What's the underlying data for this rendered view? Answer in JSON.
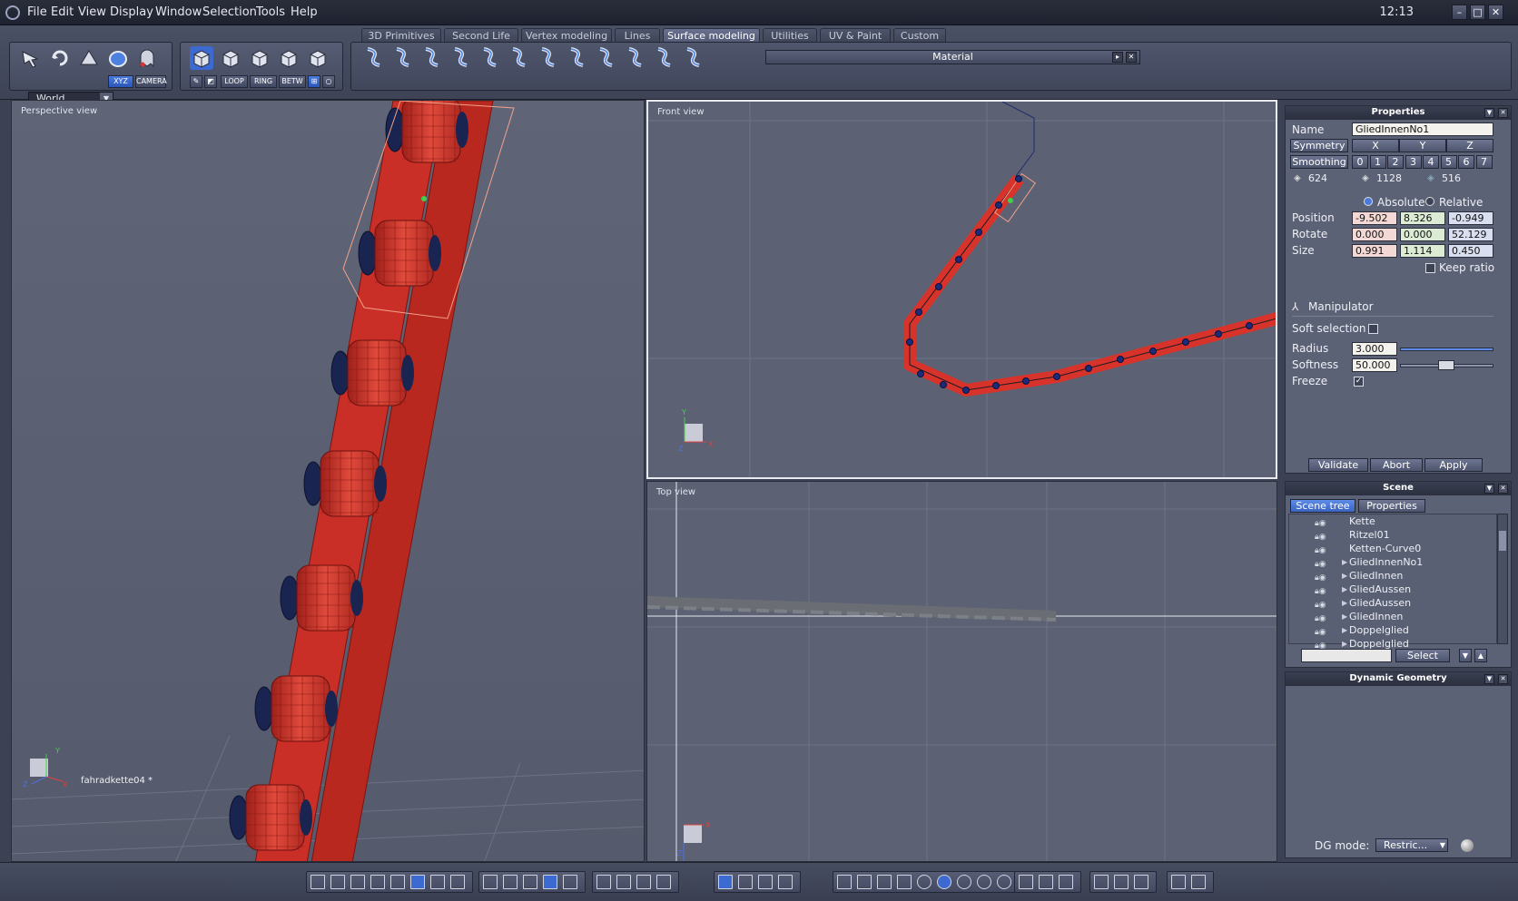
{
  "menubar": {
    "items": [
      "File",
      "Edit",
      "View",
      "Display",
      "Window",
      "Selection",
      "Tools",
      "Help"
    ],
    "clock": "12:13"
  },
  "toolbar": {
    "world_select": "World",
    "mode_buttons": [
      "XYZ",
      "CAMERA"
    ],
    "selection_buttons": [
      "LOOP",
      "RING",
      "BETW"
    ],
    "tabs": [
      "3D Primitives",
      "Second Life",
      "Vertex modeling",
      "Lines",
      "Surface modeling",
      "Utilities",
      "UV & Paint",
      "Custom"
    ],
    "active_tab": "Surface modeling",
    "material_label": "Material"
  },
  "viewports": {
    "perspective": {
      "title": "Perspective view",
      "object_label": "fahradkette04 *"
    },
    "front": {
      "title": "Front view"
    },
    "top": {
      "title": "Top view"
    }
  },
  "properties": {
    "title": "Properties",
    "name_label": "Name",
    "name_value": "GliedInnenNo1",
    "symmetry_label": "Symmetry",
    "symmetry_axes": [
      "X",
      "Y",
      "Z"
    ],
    "smoothing_label": "Smoothing",
    "smoothing_levels": [
      "0",
      "1",
      "2",
      "3",
      "4",
      "5",
      "6",
      "7"
    ],
    "counts": [
      "624",
      "1128",
      "516"
    ],
    "absolute_label": "Absolute",
    "relative_label": "Relative",
    "position_label": "Position",
    "position": [
      "-9.502",
      "8.326",
      "-0.949"
    ],
    "rotate_label": "Rotate",
    "rotate": [
      "0.000",
      "0.000",
      "52.129"
    ],
    "size_label": "Size",
    "size": [
      "0.991",
      "1.114",
      "0.450"
    ],
    "keep_ratio_label": "Keep ratio",
    "manipulator_label": "Manipulator",
    "soft_selection_label": "Soft selection",
    "radius_label": "Radius",
    "radius_value": "3.000",
    "softness_label": "Softness",
    "softness_value": "50.000",
    "freeze_label": "Freeze",
    "freeze_checked": true,
    "buttons": {
      "validate": "Validate",
      "abort": "Abort",
      "apply": "Apply"
    }
  },
  "scene": {
    "title": "Scene",
    "tabs": [
      "Scene tree",
      "Properties"
    ],
    "items": [
      "Kette",
      "Ritzel01",
      "Ketten-Curve0",
      "GliedInnenNo1",
      "GliedInnen",
      "GliedAussen",
      "GliedAussen",
      "GliedInnen",
      "Doppelglied",
      "Doppelglied"
    ],
    "select_button": "Select"
  },
  "dynamic_geometry": {
    "title": "Dynamic Geometry",
    "dg_mode_label": "DG mode:",
    "dg_mode_value": "Restric..."
  },
  "colors": {
    "accent_tab": "#6a7190",
    "chain_red": "#d8332b",
    "viewport_bg": "#5a6072"
  }
}
